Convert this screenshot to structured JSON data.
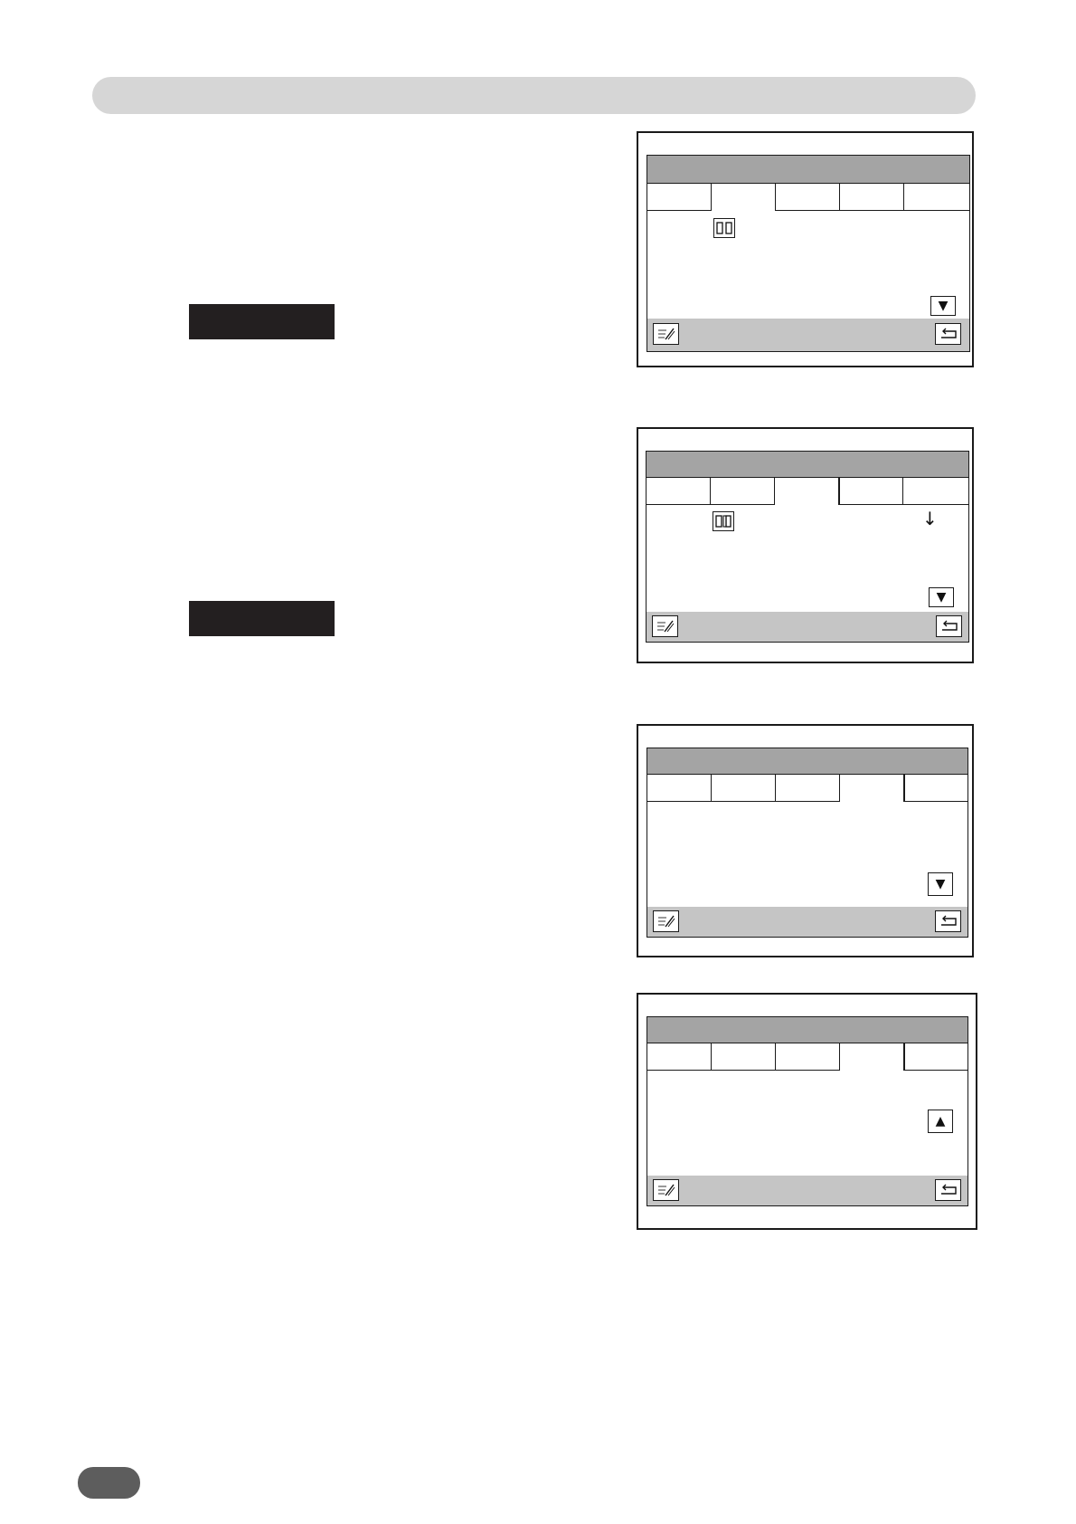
{
  "page": {
    "section_header": "",
    "page_number": ""
  },
  "screens": [
    {
      "name": "screen-1",
      "active_tab": 2,
      "tabs": [
        "",
        "",
        "",
        "",
        ""
      ],
      "scroll": "down",
      "scroll_glyph": "▼",
      "has_glyph_box": true,
      "has_down_arrow": false
    },
    {
      "name": "screen-2",
      "active_tab": 3,
      "tabs": [
        "",
        "",
        "",
        "",
        ""
      ],
      "scroll": "down",
      "scroll_glyph": "▼",
      "has_glyph_box": true,
      "has_down_arrow": true,
      "down_arrow_glyph": "↓"
    },
    {
      "name": "screen-3",
      "active_tab": 4,
      "tabs": [
        "",
        "",
        "",
        "",
        ""
      ],
      "scroll": "down",
      "scroll_glyph": "▼",
      "has_glyph_box": false,
      "has_down_arrow": false
    },
    {
      "name": "screen-4",
      "active_tab": 4,
      "tabs": [
        "",
        "",
        "",
        "",
        ""
      ],
      "scroll": "up",
      "scroll_glyph": "▲",
      "has_glyph_box": false,
      "has_down_arrow": false
    }
  ],
  "icons": {
    "edit": "edit-icon",
    "back": "back-icon",
    "scroll_down": "scroll-down-icon",
    "scroll_up": "scroll-up-icon",
    "double_page": "double-page-icon"
  }
}
